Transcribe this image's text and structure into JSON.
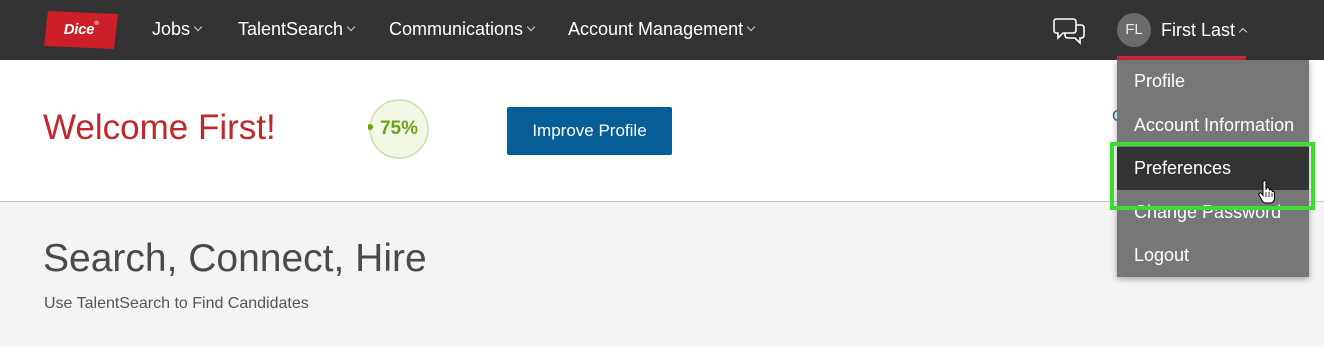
{
  "logo": {
    "text": "Dice",
    "mark": "®"
  },
  "nav": [
    {
      "label": "Jobs"
    },
    {
      "label": "TalentSearch"
    },
    {
      "label": "Communications"
    },
    {
      "label": "Account Management"
    }
  ],
  "icons": {
    "chat": "chat-bubbles-icon",
    "cursor": "hand-pointer-cursor"
  },
  "user": {
    "initials": "FL",
    "name": "First Last"
  },
  "welcome": {
    "heading": "Welcome First!",
    "profile_completion": "75%",
    "profile_completion_value": 75,
    "improve_button": "Improve Profile",
    "partial_link": "C"
  },
  "hero": {
    "title": "Search, Connect, Hire",
    "subtitle": "Use TalentSearch to Find Candidates"
  },
  "user_menu": {
    "items": [
      {
        "label": "Profile"
      },
      {
        "label": "Account Information"
      },
      {
        "label": "Preferences"
      },
      {
        "label": "Change Password"
      },
      {
        "label": "Logout"
      }
    ],
    "selected": "Preferences"
  },
  "colors": {
    "topbar": "#333333",
    "brand_red": "#c1272d",
    "button_blue": "#075d96",
    "progress_green": "#6aa419",
    "highlight_green": "#3bdc2b",
    "menu_bg": "#777777"
  }
}
